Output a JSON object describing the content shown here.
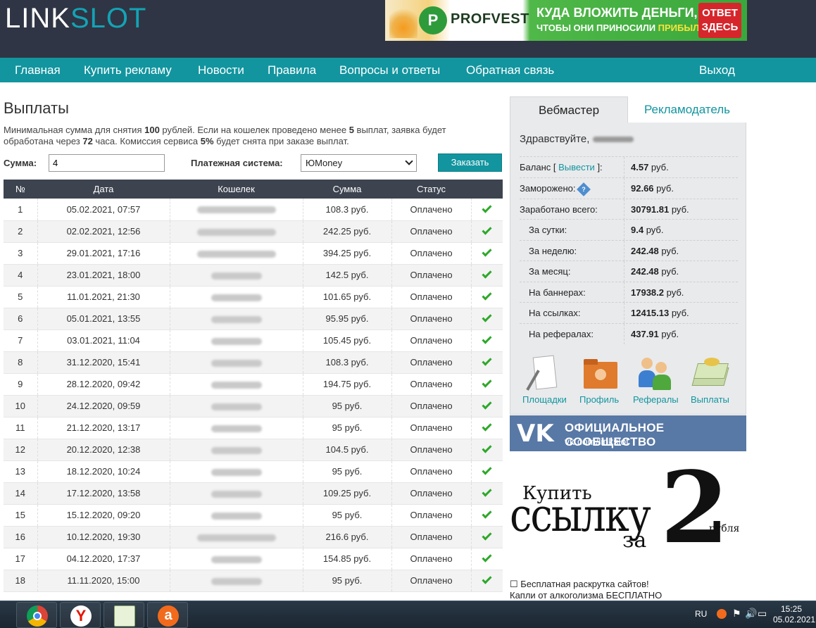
{
  "header": {
    "logo_part1": "LINK",
    "logo_part2": "SLOT",
    "banner": {
      "brand": "PROFVEST",
      "line1": "КУДА ВЛОЖИТЬ ДЕНЬГИ,",
      "line2_prefix": "ЧТОБЫ ОНИ ПРИНОСИЛИ ",
      "line2_highlight": "ПРИБЫЛЬ?",
      "cta": "ОТВЕТ ЗДЕСЬ"
    }
  },
  "nav": {
    "items": [
      "Главная",
      "Купить рекламу",
      "Новости",
      "Правила",
      "Вопросы и ответы",
      "Обратная связь"
    ],
    "logout": "Выход"
  },
  "main": {
    "title": "Выплаты",
    "info": {
      "t1": "Минимальная сумма для снятия ",
      "min": "100",
      "t2": " рублей. Если на кошелек проведено менее ",
      "count": "5",
      "t3": " выплат, заявка будет обработана через ",
      "hours": "72",
      "t4": " часа. Комиссия сервиса ",
      "fee": "5%",
      "t5": " будет снята при заказе выплат."
    },
    "form": {
      "amount_label": "Сумма:",
      "amount_value": "4",
      "system_label": "Платежная система:",
      "system_value": "ЮMoney",
      "order_button": "Заказать"
    },
    "table": {
      "headers": [
        "№",
        "Дата",
        "Кошелек",
        "Сумма",
        "Статус"
      ],
      "rows": [
        {
          "n": "1",
          "date": "05.02.2021, 07:57",
          "amount": "108.3 руб.",
          "status": "Оплачено"
        },
        {
          "n": "2",
          "date": "02.02.2021, 12:56",
          "amount": "242.25 руб.",
          "status": "Оплачено"
        },
        {
          "n": "3",
          "date": "29.01.2021, 17:16",
          "amount": "394.25 руб.",
          "status": "Оплачено"
        },
        {
          "n": "4",
          "date": "23.01.2021, 18:00",
          "amount": "142.5 руб.",
          "status": "Оплачено"
        },
        {
          "n": "5",
          "date": "11.01.2021, 21:30",
          "amount": "101.65 руб.",
          "status": "Оплачено"
        },
        {
          "n": "6",
          "date": "05.01.2021, 13:55",
          "amount": "95.95 руб.",
          "status": "Оплачено"
        },
        {
          "n": "7",
          "date": "03.01.2021, 11:04",
          "amount": "105.45 руб.",
          "status": "Оплачено"
        },
        {
          "n": "8",
          "date": "31.12.2020, 15:41",
          "amount": "108.3 руб.",
          "status": "Оплачено"
        },
        {
          "n": "9",
          "date": "28.12.2020, 09:42",
          "amount": "194.75 руб.",
          "status": "Оплачено"
        },
        {
          "n": "10",
          "date": "24.12.2020, 09:59",
          "amount": "95 руб.",
          "status": "Оплачено"
        },
        {
          "n": "11",
          "date": "21.12.2020, 13:17",
          "amount": "95 руб.",
          "status": "Оплачено"
        },
        {
          "n": "12",
          "date": "20.12.2020, 12:38",
          "amount": "104.5 руб.",
          "status": "Оплачено"
        },
        {
          "n": "13",
          "date": "18.12.2020, 10:24",
          "amount": "95 руб.",
          "status": "Оплачено"
        },
        {
          "n": "14",
          "date": "17.12.2020, 13:58",
          "amount": "109.25 руб.",
          "status": "Оплачено"
        },
        {
          "n": "15",
          "date": "15.12.2020, 09:20",
          "amount": "95 руб.",
          "status": "Оплачено"
        },
        {
          "n": "16",
          "date": "10.12.2020, 19:30",
          "amount": "216.6 руб.",
          "status": "Оплачено"
        },
        {
          "n": "17",
          "date": "04.12.2020, 17:37",
          "amount": "154.85 руб.",
          "status": "Оплачено"
        },
        {
          "n": "18",
          "date": "11.11.2020, 15:00",
          "amount": "95 руб.",
          "status": "Оплачено"
        }
      ]
    }
  },
  "sidebar": {
    "tab_webmaster": "Вебмастер",
    "tab_advertiser": "Рекламодатель",
    "greeting": "Здравствуйте,",
    "stats": [
      {
        "key": "balance",
        "label": "Баланс [ ",
        "link": "Вывести",
        "label_end": " ]:",
        "value": "4.57",
        "unit": " руб."
      },
      {
        "key": "frozen",
        "label": "Заморожено:",
        "value": "92.66",
        "unit": " руб."
      },
      {
        "key": "total",
        "label": "Заработано всего:",
        "value": "30791.81",
        "unit": " руб."
      },
      {
        "key": "day",
        "label": "За сутки:",
        "value": "9.4",
        "unit": " руб."
      },
      {
        "key": "week",
        "label": "За неделю:",
        "value": "242.48",
        "unit": " руб."
      },
      {
        "key": "month",
        "label": "За месяц:",
        "value": "242.48",
        "unit": " руб."
      },
      {
        "key": "banners",
        "label": "На баннерах:",
        "value": "17938.2",
        "unit": " руб."
      },
      {
        "key": "links",
        "label": "На ссылках:",
        "value": "12415.13",
        "unit": " руб."
      },
      {
        "key": "referrals",
        "label": "На рефералах:",
        "value": "437.91",
        "unit": " руб."
      }
    ],
    "quick_links": [
      "Площадки",
      "Профиль",
      "Рефералы",
      "Выплаты"
    ],
    "vk": {
      "title": "ОФИЦИАЛЬНОЕ СООБЩЕСТВО",
      "url": "vk.com/linkslot"
    },
    "promo": {
      "buy": "Купить",
      "link": "ссылку",
      "for": "за",
      "price": "2",
      "currency": "рубля"
    },
    "text_links": [
      "☐ Бесплатная раскрутка сайтов!",
      "Капли от алкоголизма БЕСПЛАТНО"
    ]
  },
  "taskbar": {
    "lang": "RU",
    "time": "15:25",
    "date": "05.02.2021"
  }
}
